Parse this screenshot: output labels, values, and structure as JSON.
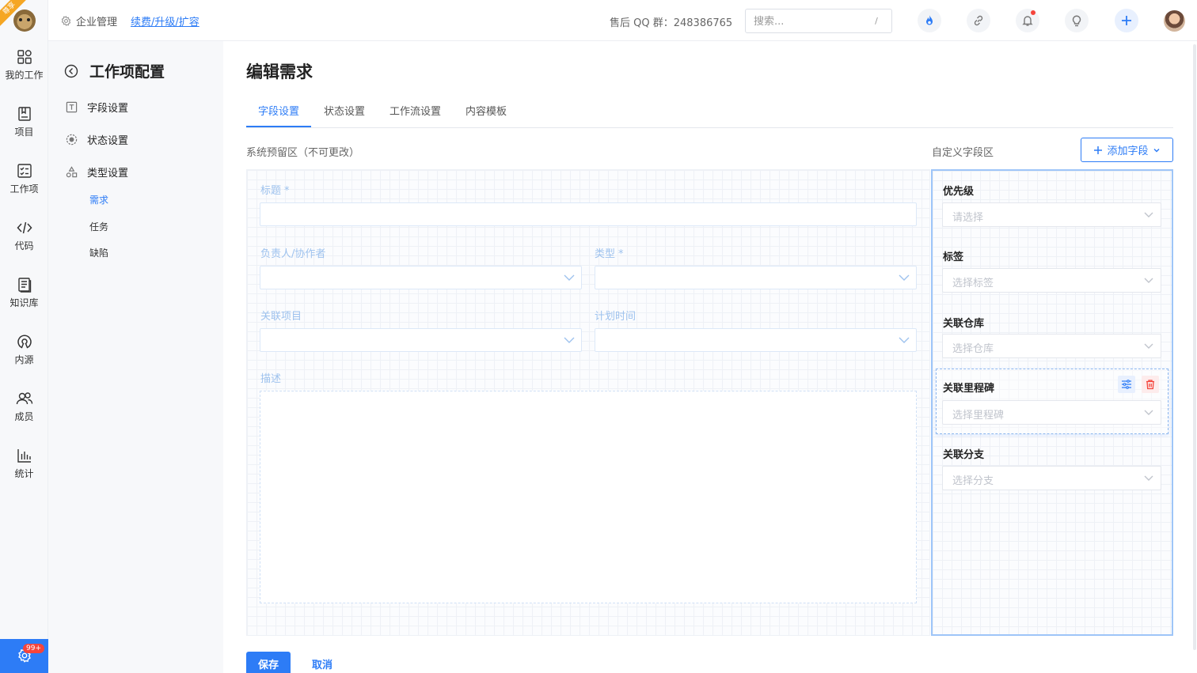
{
  "app": {
    "logo_ribbon": "尊享"
  },
  "rail": {
    "items": [
      {
        "label": "我的工作",
        "icon": "grid-icon"
      },
      {
        "label": "项目",
        "icon": "book-icon"
      },
      {
        "label": "工作项",
        "icon": "checklist-icon"
      },
      {
        "label": "代码",
        "icon": "code-icon"
      },
      {
        "label": "知识库",
        "icon": "document-icon"
      },
      {
        "label": "内源",
        "icon": "open-source-icon"
      },
      {
        "label": "成员",
        "icon": "members-icon"
      },
      {
        "label": "统计",
        "icon": "bar-chart-icon"
      }
    ],
    "settings_badge": "99+"
  },
  "topbar": {
    "enterprise_label": "企业管理",
    "renew_link": "续费/升级/扩容",
    "qq_group": "售后 QQ 群：248386765",
    "search_placeholder": "搜索...",
    "search_shortcut": "/"
  },
  "submenu": {
    "title": "工作项配置",
    "items": [
      {
        "label": "字段设置"
      },
      {
        "label": "状态设置"
      },
      {
        "label": "类型设置"
      }
    ],
    "sub_items": [
      {
        "label": "需求",
        "active": true
      },
      {
        "label": "任务",
        "active": false
      },
      {
        "label": "缺陷",
        "active": false
      }
    ]
  },
  "main": {
    "title": "编辑需求",
    "tabs": [
      {
        "label": "字段设置",
        "active": true
      },
      {
        "label": "状态设置",
        "active": false
      },
      {
        "label": "工作流设置",
        "active": false
      },
      {
        "label": "内容模板",
        "active": false
      }
    ],
    "system_zone_label": "系统预留区（不可更改）",
    "custom_zone_label": "自定义字段区",
    "add_field_label": "添加字段",
    "system_fields": {
      "title": "标题",
      "assignee": "负责人/协作者",
      "type": "类型",
      "project": "关联项目",
      "schedule": "计划时间",
      "description": "描述",
      "required_mark": "*"
    },
    "custom_fields": [
      {
        "label": "优先级",
        "placeholder": "请选择"
      },
      {
        "label": "标签",
        "placeholder": "选择标签"
      },
      {
        "label": "关联仓库",
        "placeholder": "选择仓库"
      },
      {
        "label": "关联里程碑",
        "placeholder": "选择里程碑"
      },
      {
        "label": "关联分支",
        "placeholder": "选择分支"
      }
    ],
    "save_label": "保存",
    "cancel_label": "取消"
  },
  "colors": {
    "accent": "#2d7cf6",
    "danger": "#f5443b",
    "custom_zone_border": "#9ec5f8"
  }
}
